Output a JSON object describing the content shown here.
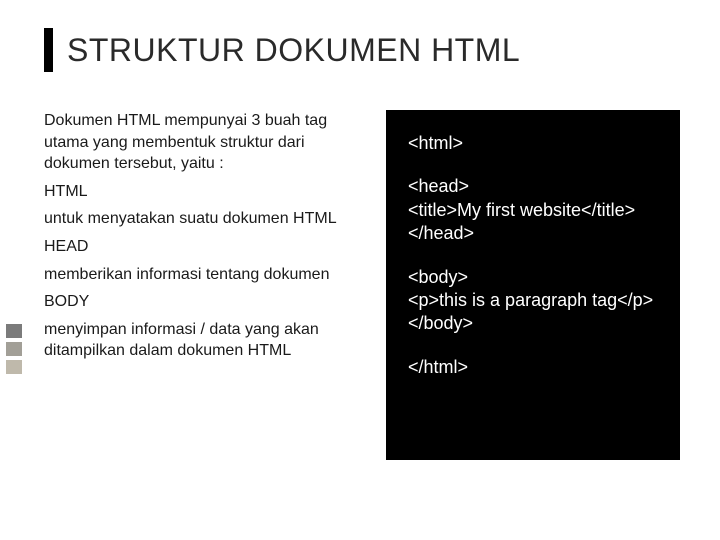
{
  "title": "STRUKTUR DOKUMEN HTML",
  "left": {
    "intro": "Dokumen HTML mempunyai 3 buah tag utama yang membentuk struktur dari dokumen tersebut, yaitu :",
    "t1": "HTML",
    "d1": "untuk menyatakan suatu dokumen HTML",
    "t2": "HEAD",
    "d2": "memberikan informasi tentang dokumen",
    "t3": "BODY",
    "d3": "menyimpan informasi / data yang akan ditampilkan dalam dokumen HTML"
  },
  "code": {
    "l1": "<html>",
    "l2": "<head>",
    "l3": "<title>My first website</title>",
    "l4": "</head>",
    "l5": "<body>",
    "l6": "<p>this is a paragraph tag</p>",
    "l7": "</body>",
    "l8": "</html>"
  }
}
